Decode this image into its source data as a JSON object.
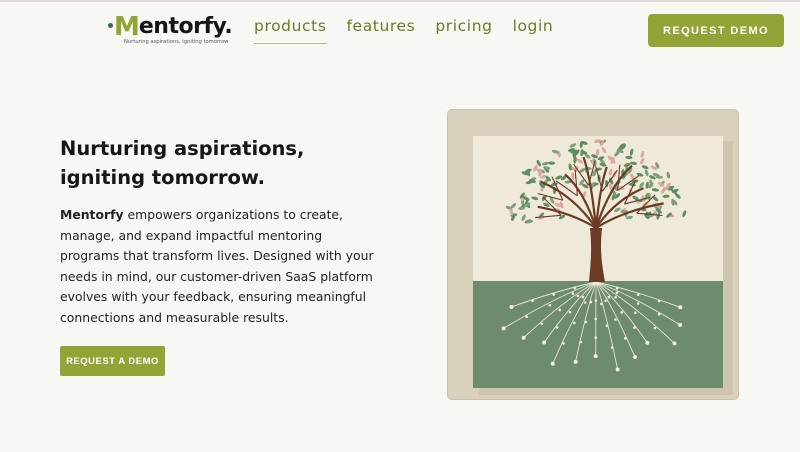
{
  "brand": {
    "logo_m": "M",
    "logo_rest": "entorfy.",
    "tagline": "Nurturing aspirations, igniting tomorrow"
  },
  "nav": {
    "items": [
      {
        "label": "products",
        "active": true
      },
      {
        "label": "features",
        "active": false
      },
      {
        "label": "pricing",
        "active": false
      },
      {
        "label": "login",
        "active": false
      }
    ],
    "cta_label": "REQUEST DEMO"
  },
  "hero": {
    "title": "Nurturing aspirations, igniting tomorrow.",
    "body_brand": "Mentorfy",
    "body_text": " empowers organizations to create, manage, and expand impactful mentoring programs that transform lives. Designed with your needs in mind, our customer-driven SaaS platform evolves with your feedback, ensuring meaningful connections and measurable results.",
    "cta_label": "REQUEST A DEMO"
  },
  "colors": {
    "accent": "#93a335",
    "nav_text": "#6d7a25",
    "logo_dot": "#3d6a48",
    "art_sky": "#efe9d9",
    "art_ground": "#6f8b6e",
    "art_trunk": "#6a3a24",
    "art_leaf": "#5f8d63"
  },
  "artwork": {
    "icon": "tree-with-roots-illustration"
  }
}
